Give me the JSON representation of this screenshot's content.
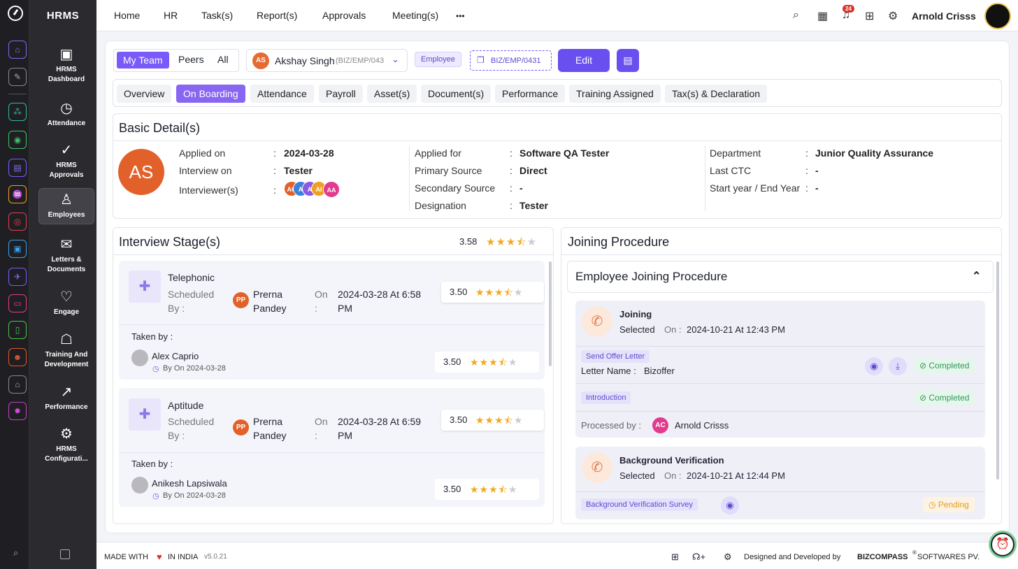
{
  "app": {
    "name": "HRMS"
  },
  "rail_icons": [
    "home-icon",
    "pin-icon",
    "org-icon",
    "gauge-icon",
    "briefcase-icon",
    "hands-icon",
    "target-icon",
    "box-icon",
    "flight-icon",
    "monitor-icon",
    "doc-icon",
    "house-icon",
    "settings-icon"
  ],
  "sidebar": {
    "items": [
      {
        "label": "HRMS Dashboard",
        "icon": "dashboard-icon"
      },
      {
        "label": "Attendance",
        "icon": "calendar-clock-icon"
      },
      {
        "label": "HRMS Approvals",
        "icon": "approvals-icon"
      },
      {
        "label": "Employees",
        "icon": "user-icon"
      },
      {
        "label": "Letters & Documents",
        "icon": "mail-icon"
      },
      {
        "label": "Engage",
        "icon": "handshake-icon"
      },
      {
        "label": "Training And Development",
        "icon": "training-icon"
      },
      {
        "label": "Performance",
        "icon": "chart-icon"
      },
      {
        "label": "HRMS Configurati...",
        "icon": "gear-icon"
      }
    ]
  },
  "topnav": {
    "items": [
      "Home",
      "HR",
      "Task(s)",
      "Report(s)",
      "Approvals",
      "Meeting(s)"
    ],
    "more": "•••",
    "notification_count": "24",
    "user": "Arnold Crisss"
  },
  "toolbar": {
    "segments": [
      "My Team",
      "Peers",
      "All"
    ],
    "employee_initials": "AS",
    "employee_name": "Akshay Singh",
    "employee_code_inline": "(BIZ/EMP/043",
    "role_pill": "Employee",
    "code_pill": "BIZ/EMP/0431",
    "edit": "Edit"
  },
  "tabs": [
    "Overview",
    "On Boarding",
    "Attendance",
    "Payroll",
    "Asset(s)",
    "Document(s)",
    "Performance",
    "Training Assigned",
    "Tax(s) & Declaration"
  ],
  "basic": {
    "title": "Basic Detail(s)",
    "initials": "AS",
    "col1": [
      {
        "label": "Applied on",
        "value": "2024-03-28"
      },
      {
        "label": "Interview on",
        "value": "Tester"
      },
      {
        "label": "Interviewer(s)",
        "value": ""
      }
    ],
    "interviewers": [
      "AC",
      "A",
      "A",
      "AI",
      "AA"
    ],
    "col2": [
      {
        "label": "Applied for",
        "value": "Software QA Tester"
      },
      {
        "label": "Primary Source",
        "value": "Direct"
      },
      {
        "label": "Secondary Source",
        "value": "-"
      },
      {
        "label": "Designation",
        "value": "Tester"
      }
    ],
    "col3": [
      {
        "label": "Department",
        "value": "Junior Quality Assurance"
      },
      {
        "label": "Last CTC",
        "value": "-"
      },
      {
        "label": "Start year / End Year",
        "value": "-"
      }
    ]
  },
  "interview": {
    "title": "Interview Stage(s)",
    "rating": "3.58",
    "stages": [
      {
        "name": "Telephonic",
        "scheduled_by_label": "Scheduled By :",
        "initials": "PP",
        "scheduler": "Prerna Pandey",
        "on_label": "On :",
        "datetime": "2024-03-28 At 6:58 PM",
        "rating": "3.50",
        "taken_by_label": "Taken by :",
        "taker": "Alex Caprio",
        "taker_date": "By On 2024-03-28",
        "taker_rating": "3.50"
      },
      {
        "name": "Aptitude",
        "scheduled_by_label": "Scheduled By :",
        "initials": "PP",
        "scheduler": "Prerna Pandey",
        "on_label": "On :",
        "datetime": "2024-03-28 At 6:59 PM",
        "rating": "3.50",
        "taken_by_label": "Taken by :",
        "taker": "Anikesh Lapsiwala",
        "taker_date": "By On 2024-03-28",
        "taker_rating": "3.50"
      }
    ]
  },
  "joining": {
    "title": "Joining Procedure",
    "sub_title": "Employee Joining Procedure",
    "steps": [
      {
        "name": "Joining",
        "status": "Selected",
        "on_label": "On :",
        "datetime": "2024-10-21 At 12:43 PM"
      },
      {
        "name": "Background Verification",
        "status": "Selected",
        "on_label": "On :",
        "datetime": "2024-10-21 At 12:44 PM"
      }
    ],
    "offer_tag": "Send Offer Letter",
    "letter_label": "Letter Name :",
    "letter_name": "Bizoffer",
    "completed": "Completed",
    "intro_tag": "Introduction",
    "processed_label": "Processed by :",
    "processed_initials": "AC",
    "processed_by": "Arnold Crisss",
    "bg_tag": "Background Verification Survey",
    "pending": "Pending"
  },
  "footer": {
    "made_with": "MADE WITH",
    "in_india": "IN INDIA",
    "version": "v5.0.21",
    "designed": "Designed and Developed by",
    "company": "BIZCOMPASS",
    "company_tail": "SOFTWARES PV."
  },
  "colors": {
    "accent": "#7a5af8",
    "star": "#f2a91b",
    "completed": "#2e9a58",
    "pending": "#e49a20"
  }
}
